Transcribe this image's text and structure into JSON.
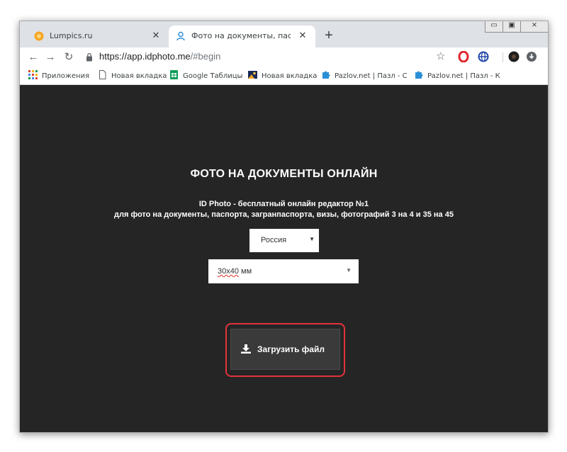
{
  "browser": {
    "tabs": [
      {
        "title": "Lumpics.ru",
        "active": false
      },
      {
        "title": "Фото на документы, паспорта, з",
        "active": true
      }
    ],
    "new_tab": "+",
    "close_glyph": "✕",
    "url_main": "https://app.idphoto.me",
    "url_tail": "/#begin",
    "window_controls": {
      "minimize": "▭",
      "maximize": "▣",
      "close": "⨯"
    }
  },
  "bookmarks": [
    {
      "label": "Приложения",
      "icon": "apps-grid-icon"
    },
    {
      "label": "Новая вкладка",
      "icon": "page-icon"
    },
    {
      "label": "Google Таблицы",
      "icon": "sheets-icon"
    },
    {
      "label": "Новая вкладка",
      "icon": "image-icon"
    },
    {
      "label": "Pazlov.net | Пазл - С",
      "icon": "puzzle-icon"
    },
    {
      "label": "Pazlov.net | Пазл - К",
      "icon": "puzzle-icon"
    }
  ],
  "page": {
    "heading": "ФОТО НА ДОКУМЕНТЫ ОНЛАЙН",
    "subtitle_line1": "ID Photo - бесплатный онлайн редактор №1",
    "subtitle_line2": "для фото на документы, паспорта, загранпаспорта, визы, фотографий 3 на 4 и 35 на 45",
    "country_select": "Россия",
    "size_select_value": "30x40",
    "size_select_unit": " мм",
    "upload_button": "Загрузить файл"
  },
  "colors": {
    "page_background": "#252525",
    "highlight_outline": "#e2333b",
    "button_background": "#3a3a3a"
  }
}
